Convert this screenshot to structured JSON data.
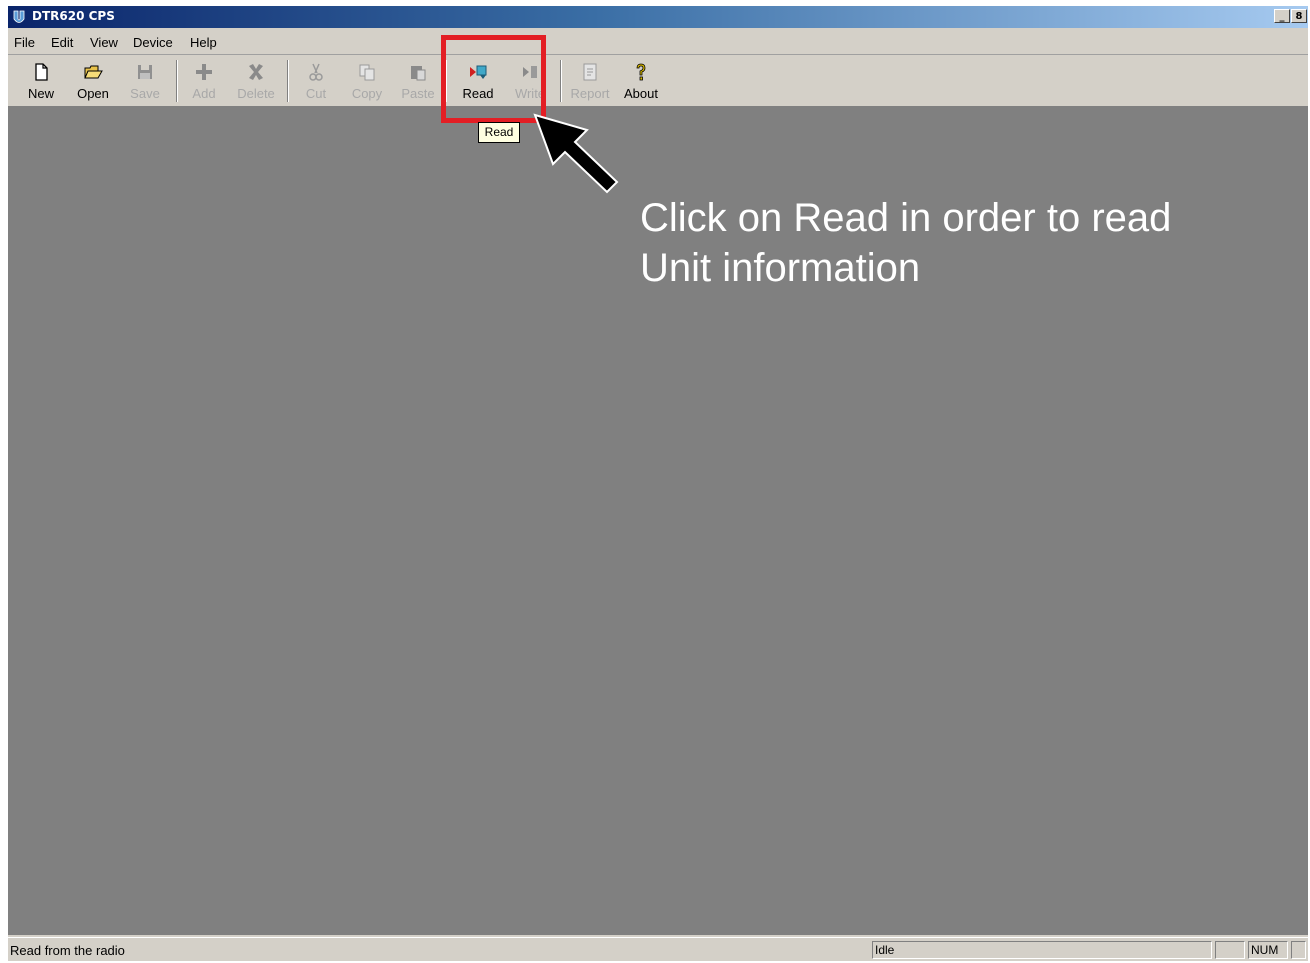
{
  "window": {
    "title": "DTR620 CPS",
    "controls": {
      "minimize": "_",
      "restore": "8"
    }
  },
  "menu": [
    "File",
    "Edit",
    "View",
    "Device",
    "Help"
  ],
  "toolbar": {
    "new": "New",
    "open": "Open",
    "save": "Save",
    "add": "Add",
    "delete": "Delete",
    "cut": "Cut",
    "copy": "Copy",
    "paste": "Paste",
    "read": "Read",
    "write": "Write",
    "report": "Report",
    "about": "About"
  },
  "tooltip": "Read",
  "annotation": {
    "text": "Click on  Read in order to read\nUnit information",
    "highlight_color": "#e31e24"
  },
  "statusbar": {
    "message": "Read from the radio",
    "state": "Idle",
    "num": "NUM"
  },
  "colors": {
    "client_background": "#808080",
    "chrome": "#d4d0c8",
    "titlebar_start": "#0a246a",
    "titlebar_end": "#a6caf0"
  }
}
